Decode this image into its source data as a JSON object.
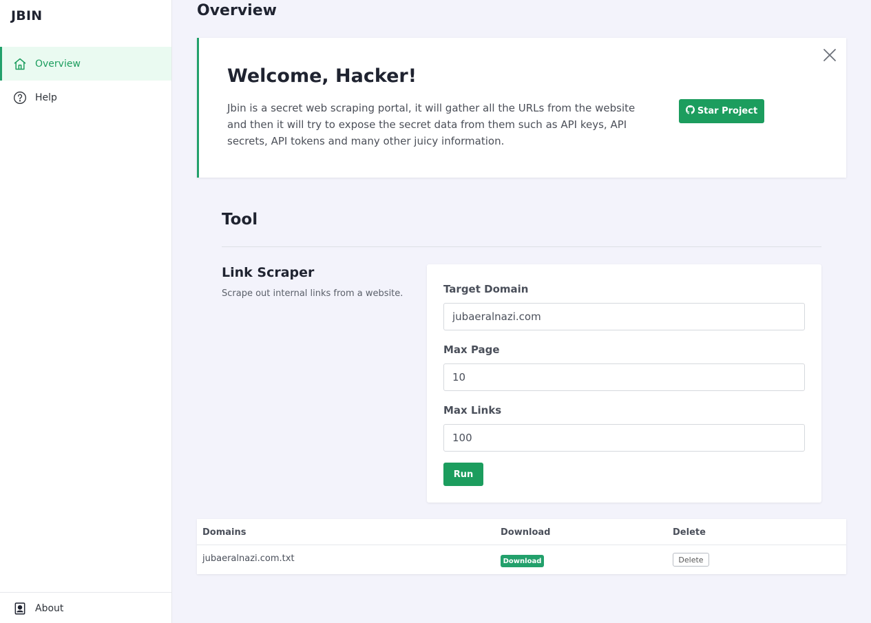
{
  "app": {
    "brand": "JBIN"
  },
  "sidebar": {
    "items": [
      {
        "label": "Overview",
        "icon": "home-icon",
        "active": true
      },
      {
        "label": "Help",
        "icon": "help-circle-icon",
        "active": false
      }
    ],
    "footer": {
      "label": "About",
      "icon": "user-badge-icon"
    }
  },
  "header": {
    "title": "Overview"
  },
  "welcome": {
    "title": "Welcome, Hacker!",
    "text": "Jbin is a secret web scraping portal, it will gather all the URLs from the website and then it will try to expose the secret data from them such as API keys, API secrets, API tokens and many other juicy information.",
    "star_button": "Star Project",
    "star_icon": "github-icon",
    "close_icon": "close-icon"
  },
  "tool": {
    "title": "Tool",
    "scraper": {
      "title": "Link Scraper",
      "description": "Scrape out internal links from a website.",
      "fields": {
        "target_domain": {
          "label": "Target Domain",
          "value": "jubaeralnazi.com"
        },
        "max_page": {
          "label": "Max Page",
          "value": "10"
        },
        "max_links": {
          "label": "Max Links",
          "value": "100"
        }
      },
      "run_button": "Run"
    }
  },
  "results": {
    "columns": [
      "Domains",
      "Download",
      "Delete"
    ],
    "rows": [
      {
        "domain": "jubaeralnazi.com.txt",
        "download_label": "Download",
        "delete_label": "Delete"
      }
    ]
  },
  "colors": {
    "accent": "#1c9d5e",
    "background": "#f3f3fb",
    "active_bg": "#eafaf1"
  }
}
